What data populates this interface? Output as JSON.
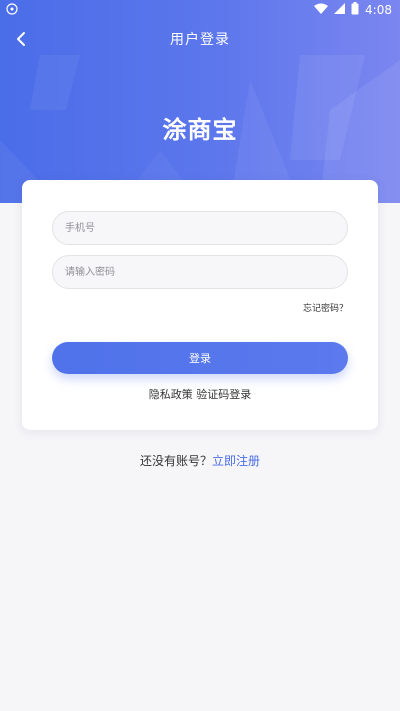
{
  "status_bar": {
    "time": "4:08",
    "icons": [
      "app-notification-icon",
      "wifi-icon",
      "signal-icon",
      "battery-icon"
    ],
    "battery_label": "B"
  },
  "app_bar": {
    "title": "用户登录",
    "back_icon": "chevron-left-icon"
  },
  "brand": {
    "name": "涂商宝"
  },
  "form": {
    "phone_placeholder": "手机号",
    "password_placeholder": "请输入密码",
    "forgot_label": "忘记密码？",
    "login_label": "登录",
    "privacy_label": "隐私政策",
    "sms_login_label": "验证码登录"
  },
  "register": {
    "prompt": "还没有账号？",
    "link": "立即注册"
  },
  "colors": {
    "primary": "#4a6de8",
    "background": "#f6f6f8",
    "card": "#ffffff"
  }
}
